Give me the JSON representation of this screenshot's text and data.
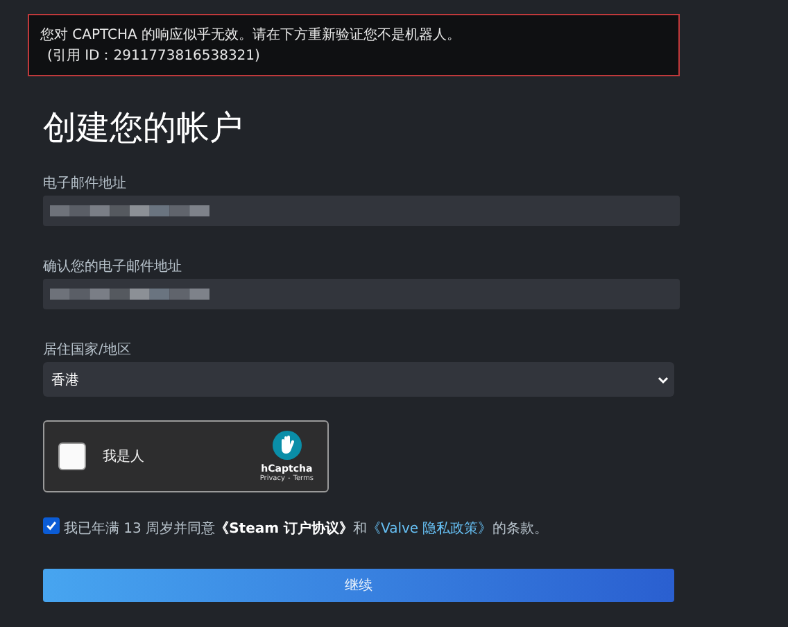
{
  "error": {
    "message": "您对 CAPTCHA 的响应似乎无效。请在下方重新验证您不是机器人。",
    "reference": "(引用 ID：2911773816538321)"
  },
  "title": "创建您的帐户",
  "fields": [
    {
      "kind": "input",
      "label": "电子邮件地址"
    },
    {
      "kind": "input",
      "label": "确认您的电子邮件地址"
    },
    {
      "kind": "select",
      "label": "居住国家/地区",
      "value": "香港"
    }
  ],
  "captcha": {
    "label": "我是人",
    "checked": false,
    "brand": "hCaptcha",
    "privacy": "Privacy",
    "separator": "-",
    "terms": "Terms"
  },
  "agreement": {
    "checked": true,
    "parts": [
      {
        "kind": "text",
        "text": "我已年满 13 周岁并同意"
      },
      {
        "kind": "strong-link",
        "text": "《Steam 订户协议》"
      },
      {
        "kind": "text",
        "text": "和"
      },
      {
        "kind": "link",
        "text": "《Valve 隐私政策》"
      },
      {
        "kind": "text",
        "text": "的条款。"
      }
    ]
  },
  "submit": "继续"
}
